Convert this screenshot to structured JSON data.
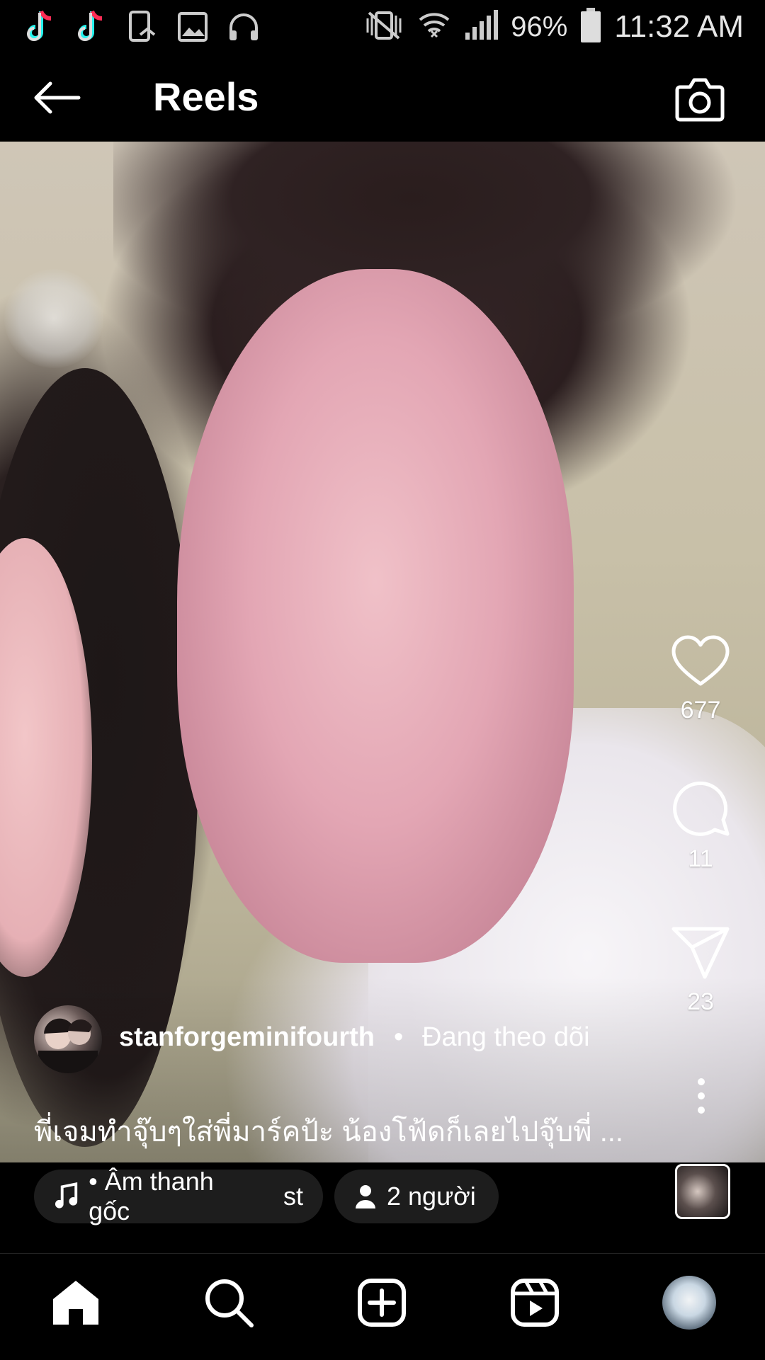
{
  "status_bar": {
    "battery_percent": "96%",
    "time": "11:32 AM",
    "left_icons": [
      "tiktok-icon",
      "tiktok-icon",
      "screen-cast-icon",
      "image-icon",
      "headset-icon"
    ],
    "right_icons": [
      "vibrate-off-icon",
      "wifi-icon",
      "signal-icon",
      "battery-icon"
    ]
  },
  "header": {
    "title": "Reels",
    "back_icon": "arrow-left-icon",
    "camera_icon": "camera-icon"
  },
  "actions": {
    "likes": "677",
    "comments": "11",
    "shares": "23"
  },
  "post": {
    "username": "stanforgeminifourth",
    "separator": "•",
    "follow_status": "Đang theo dõi",
    "caption": "พี่เจมทำจุ๊บๆใส่พี่มาร์คป้ะ น้องโฟ้ดก็เลยไปจุ๊บพี่ ..."
  },
  "audio": {
    "label": "• Âm thanh gốc",
    "suffix": "st"
  },
  "people_tag": {
    "label": "2 người"
  },
  "bottom_nav": [
    "home-icon",
    "search-icon",
    "create-post-icon",
    "reels-icon",
    "profile-avatar"
  ],
  "colors": {
    "background": "#000000",
    "pill": "#1d1d1d",
    "text": "#ffffff"
  }
}
